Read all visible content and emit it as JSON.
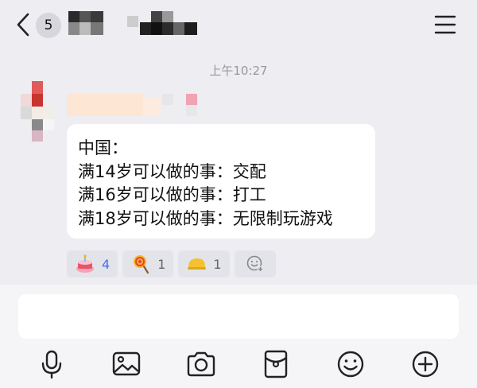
{
  "header": {
    "unread_count": "5"
  },
  "chat": {
    "timestamp": "上午10:27",
    "message_lines": [
      "中国：",
      "满14岁可以做的事：交配",
      "满16岁可以做的事：打工",
      "满18岁可以做的事：无限制玩游戏"
    ],
    "reactions": [
      {
        "icon": "cake-emoji-icon",
        "count": "4",
        "highlighted": true
      },
      {
        "icon": "lollipop-emoji-icon",
        "count": "1",
        "highlighted": false
      },
      {
        "icon": "helmet-emoji-icon",
        "count": "1",
        "highlighted": false
      }
    ]
  },
  "composer": {
    "placeholder": ""
  },
  "toolbar": {
    "items": [
      "microphone-icon",
      "image-icon",
      "camera-icon",
      "red-packet-icon",
      "emoji-icon",
      "plus-icon"
    ]
  },
  "colors": {
    "background": "#ededf2",
    "bubble": "#ffffff",
    "accent_count": "#4a6fe0",
    "timestamp": "#999999"
  }
}
